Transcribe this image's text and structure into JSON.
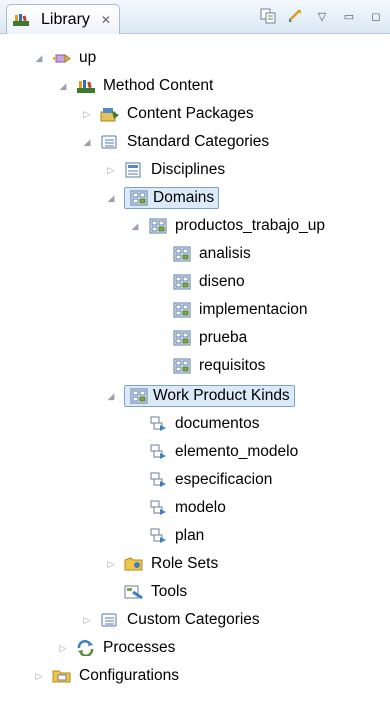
{
  "tab": {
    "title": "Library",
    "close": "✕"
  },
  "toolbar": {
    "btn1": "⎘",
    "btn2": "⇅",
    "menu": "▽",
    "minimize": "▭",
    "maximize": "◻"
  },
  "tree": {
    "up": "up",
    "method_content": "Method Content",
    "content_packages": "Content Packages",
    "standard_categories": "Standard Categories",
    "disciplines": "Disciplines",
    "domains": "Domains",
    "productos_trabajo_up": "productos_trabajo_up",
    "analisis": "analisis",
    "diseno": "diseno",
    "implementacion": "implementacion",
    "prueba": "prueba",
    "requisitos": "requisitos",
    "work_product_kinds": "Work Product Kinds",
    "documentos": "documentos",
    "elemento_modelo": "elemento_modelo",
    "especificacion": "especificacion",
    "modelo": "modelo",
    "plan": "plan",
    "role_sets": "Role Sets",
    "tools": "Tools",
    "custom_categories": "Custom Categories",
    "processes": "Processes",
    "configurations": "Configurations"
  }
}
